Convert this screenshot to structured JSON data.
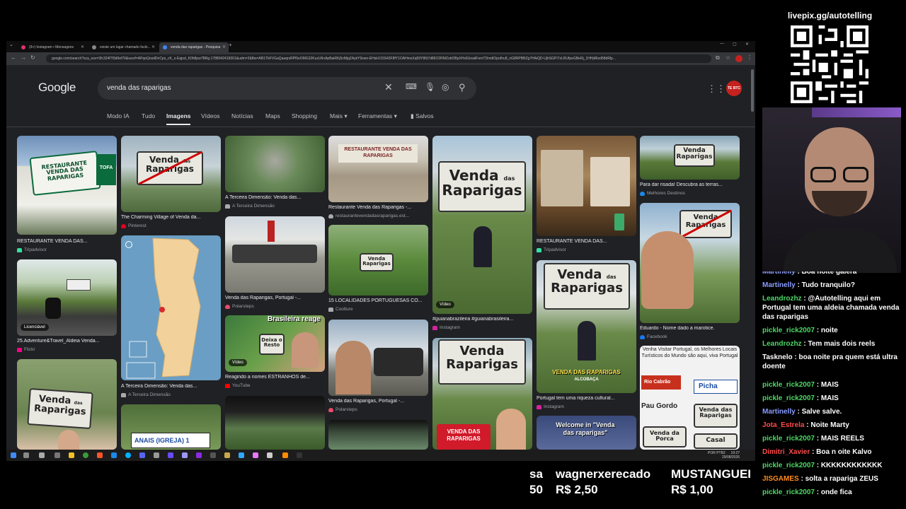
{
  "browser": {
    "tabs": [
      {
        "label": "(9+) Instagram • Mensagens"
      },
      {
        "label": "existe um lugar chamado fucki..."
      },
      {
        "label": "venda das raparigas - Pesquisa"
      }
    ],
    "url": "google.com/search?sca_esv=3fc324f7f3d9ef76&sxsrf=APqeQnsdDnCps_cK_o-Eqjod_K0h8pw7BRg:1788042418301&udm=2&fbs=AB1TbFVGaQaaqrsRPl5eOMG32KuzU6nApBaiRKj5vMjqZAykY9zwn-EHskX15S43F8fY1OAHmsXq59Y86t7d86O2RMZobOBpXHx6UoaitFomTDmdIOpoIhu8_nG8RPBBZg7HAiQD-UjhSGPI7zLRUfpeGBeRj_1HHjiRtzd58dRlp..."
  },
  "google": {
    "logo": "Google",
    "query": "venda das raparigas",
    "avatar_label": "TE BTC",
    "tabs": [
      "Modo IA",
      "Tudo",
      "Imagens",
      "Vídeos",
      "Notícias",
      "Maps",
      "Shopping",
      "Mais",
      "Ferramentas",
      "Salvos"
    ]
  },
  "results": [
    {
      "title": "RESTAURANTE VENDA DAS...",
      "source": "Tripadvisor"
    },
    {
      "title": "The Charming Village of Venda da...",
      "source": "Pinterest"
    },
    {
      "title": "A Terceira Dimensão: Venda das...",
      "source": "A Terceira Dimensão"
    },
    {
      "title": "Restaurante Venda das Raparigas -...",
      "source": "restaurantevendadasraparigas.est..."
    },
    {
      "title": "#guianabrazileira #guianabrasileira...",
      "source": "Instagram",
      "badge": "Vídeo"
    },
    {
      "title": "RESTAURANTE VENDA DAS...",
      "source": "Tripadvisor"
    },
    {
      "title": "Para dar risada! Descubra as terras...",
      "source": "Melhores Destinos"
    },
    {
      "title": "25.Adventure&Travel_Aldeia Venda...",
      "source": "Flickr",
      "badge": "Licenciável"
    },
    {
      "title": "A Terceira Dimensão: Venda das...",
      "source": "A Terceira Dimensão"
    },
    {
      "title": "Venda das Raparigas, Portugal -...",
      "source": "Polarsteps"
    },
    {
      "title": "15 LOCALIDADES PORTUGUESAS CO...",
      "source": "Coolture"
    },
    {
      "title": "Portugal tem uma riqueza cultural...",
      "source": "Instagram"
    },
    {
      "title": "Eduardo - Nome dado a marotice.",
      "source": "Facebook"
    },
    {
      "title": "Reagindo a nomes ESTRANHOS de...",
      "source": "YouTube",
      "badge": "Vídeo"
    },
    {
      "title": "Venda das Raparigas, Portugal -...",
      "source": "Polarsteps"
    }
  ],
  "image_text": {
    "restaurant_sign": "RESTAURANTE VENDA DAS RAPARIGAS",
    "sign_words": [
      "Venda",
      "das",
      "Raparigas"
    ],
    "reaction_title": "Brasileira reage",
    "reaction_signs": [
      "Deixa o Resto",
      "Venda das Raparigas",
      "Picha",
      "Pau Gordo",
      "Rio Cabrão",
      "Casal",
      "Venda da Porca"
    ],
    "promo": "Venha Visitar Portugal, os Melhores Locais Turísticos do Mundo são aqui, viva Portugal",
    "red_caption": "VENDA DAS RAPARIGAS",
    "town": "ALCOBAÇA",
    "welcome": "Welcome in \"Venda das raparigas\"",
    "anais": "ANAIS (IGREJA) 1",
    "tofa": "TOFA"
  },
  "taskbar": {
    "clock": "19:27",
    "date": "29/08/2026",
    "lang": "POR PTB2"
  },
  "donations": [
    {
      "name": "sa",
      "amount": "50"
    },
    {
      "name": "wagnerxerecado",
      "amount": "R$ 2,50"
    },
    {
      "name": "MUSTANGUEI",
      "amount": "R$ 1,00"
    }
  ],
  "overlay": {
    "livepix": "livepix.gg/autotelling"
  },
  "chat": [
    {
      "user": "Martinelly",
      "text": ": Boa noite galera",
      "color": "#8a9cff"
    },
    {
      "user": "Martinelly",
      "text": ": Tudo tranquilo?",
      "color": "#8a9cff"
    },
    {
      "user": "Leandrozhz",
      "text": ": @Autotelling aqui em Portugal tem uma aldeia chamada venda das raparigas",
      "color": "#4cd964"
    },
    {
      "user": "pickle_rick2007",
      "text": ": noite",
      "color": "#4cd964"
    },
    {
      "user": "Leandrozhz",
      "text": ": Tem mais dois reels",
      "color": "#4cd964"
    },
    {
      "user": "Tasknelo",
      "text": ": boa noite pra quem está ultra doente",
      "color": "#ffffff"
    },
    {
      "user": "pickle_rick2007",
      "text": ": MAIS",
      "color": "#4cd964"
    },
    {
      "user": "pickle_rick2007",
      "text": ": MAIS",
      "color": "#4cd964"
    },
    {
      "user": "Martinelly",
      "text": ": Salve salve.",
      "color": "#8a9cff"
    },
    {
      "user": "Jota_Estrela",
      "text": ": Noite Marty",
      "color": "#ff4b4b"
    },
    {
      "user": "pickle_rick2007",
      "text": ": MAIS REELS",
      "color": "#4cd964"
    },
    {
      "user": "Dimitri_Xavier",
      "text": ": Boa n oite Kalvo",
      "color": "#ff4b4b"
    },
    {
      "user": "pickle_rick2007",
      "text": ": KKKKKKKKKKKK",
      "color": "#4cd964"
    },
    {
      "user": "JISGAMES",
      "text": ": solta a rapariga ZEUS",
      "color": "#ff8c1a"
    },
    {
      "user": "pickle_rick2007",
      "text": ": onde fica",
      "color": "#4cd964"
    }
  ]
}
